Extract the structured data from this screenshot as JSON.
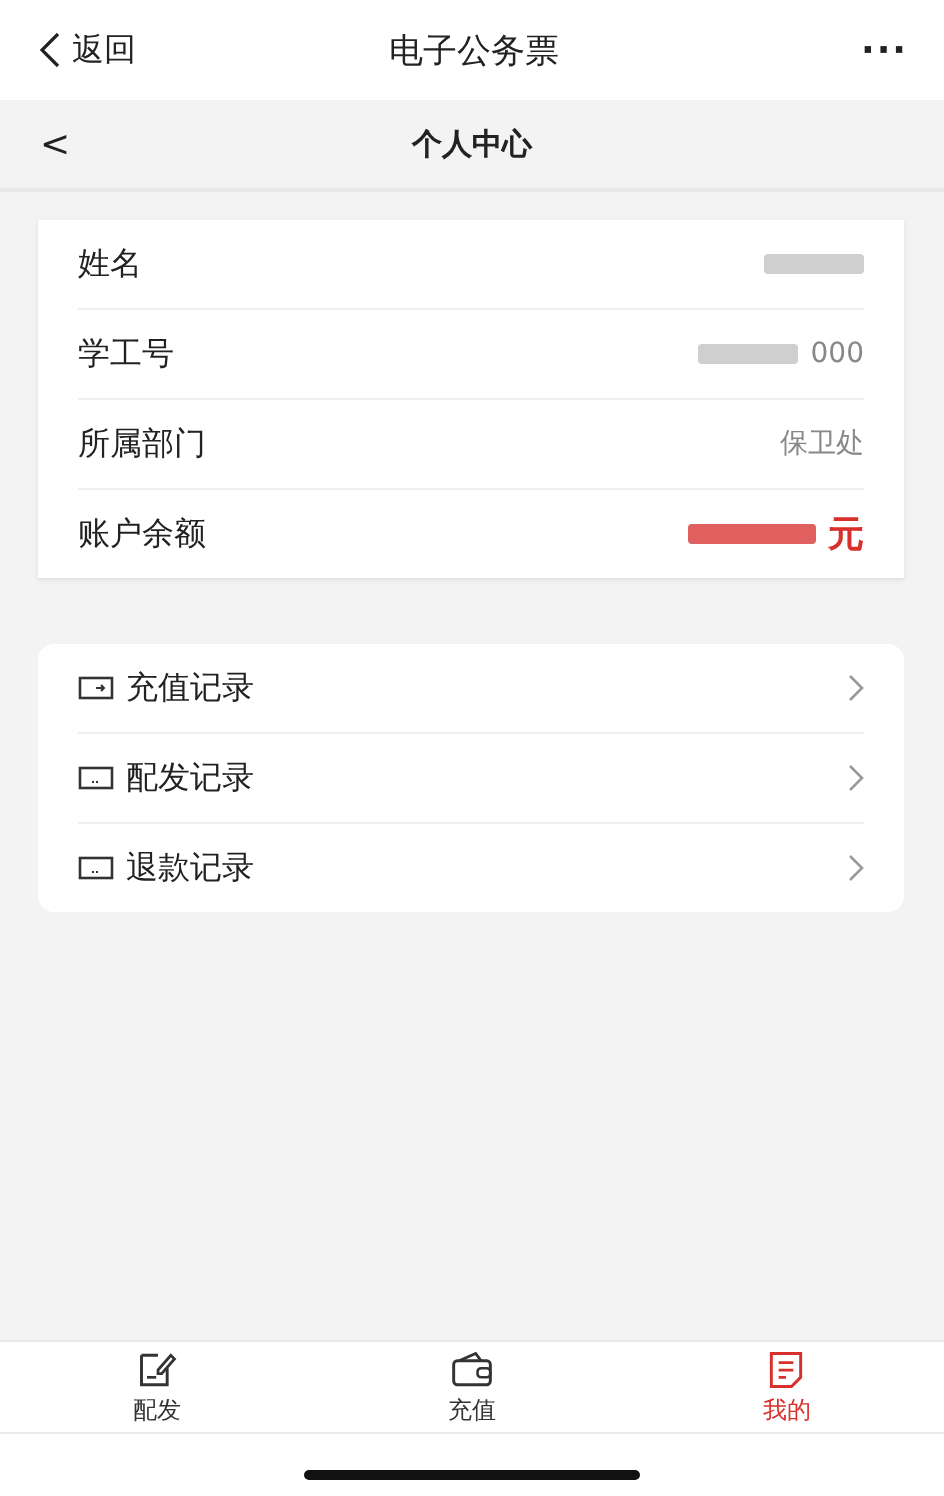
{
  "top_bar": {
    "back": "返回",
    "title": "电子公务票",
    "more": "···"
  },
  "header": {
    "back": "<",
    "title": "个人中心"
  },
  "profile": [
    {
      "label": "姓名",
      "kind": "text",
      "redacted": true
    },
    {
      "label": "学工号",
      "kind": "text",
      "value": "000",
      "redacted": true
    },
    {
      "label": "所属部门",
      "kind": "text",
      "value": "保卫处",
      "redacted": false
    },
    {
      "label": "账户余额",
      "kind": "amount",
      "value": "元",
      "redacted": true
    }
  ],
  "records": [
    {
      "label": "充值记录"
    },
    {
      "label": "配发记录"
    },
    {
      "label": "退款记录"
    }
  ],
  "tabs": [
    {
      "label": "配发",
      "kind": "edit",
      "selected": false
    },
    {
      "label": "充值",
      "kind": "wallet",
      "selected": false
    },
    {
      "label": "我的",
      "kind": "note",
      "selected": true
    }
  ]
}
